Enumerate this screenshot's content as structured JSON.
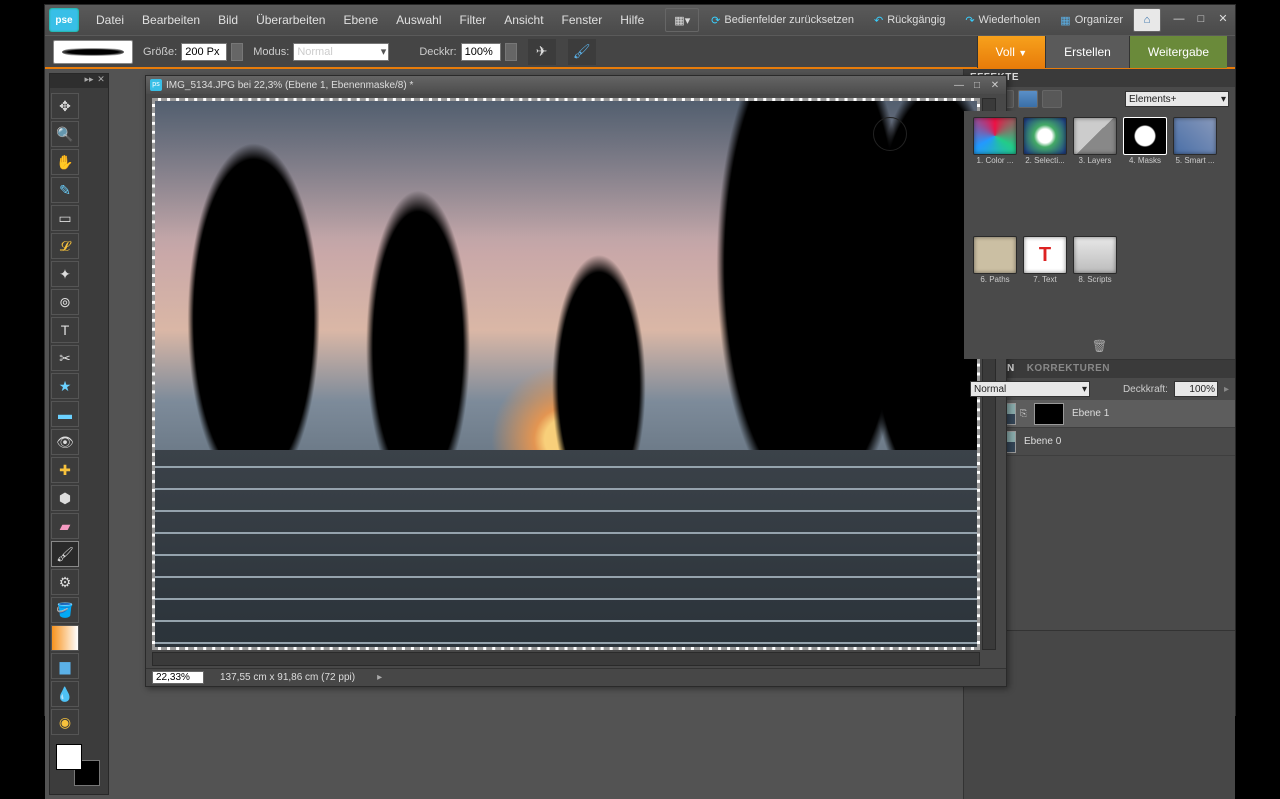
{
  "menu": {
    "items": [
      "Datei",
      "Bearbeiten",
      "Bild",
      "Überarbeiten",
      "Ebene",
      "Auswahl",
      "Filter",
      "Ansicht",
      "Fenster",
      "Hilfe"
    ]
  },
  "topbuttons": {
    "reset": "Bedienfelder zurücksetzen",
    "undo": "Rückgängig",
    "redo": "Wiederholen",
    "organizer": "Organizer"
  },
  "options": {
    "size_label": "Größe:",
    "size_value": "200 Px",
    "mode_label": "Modus:",
    "mode_value": "Normal",
    "opacity_label": "Deckkr:",
    "opacity_value": "100%"
  },
  "tabs": {
    "full": "Voll",
    "create": "Erstellen",
    "share": "Weitergabe"
  },
  "doc": {
    "title": "IMG_5134.JPG bei 22,3% (Ebene 1, Ebenenmaske/8) *",
    "zoom": "22,33%",
    "dims": "137,55 cm x 91,86 cm (72 ppi)"
  },
  "effects": {
    "title": "EFFEKTE",
    "dropdown": "Elements+",
    "items": [
      "1. Color ...",
      "2. Selecti...",
      "3. Layers",
      "4. Masks",
      "5. Smart ...",
      "6. Paths",
      "7. Text",
      "8. Scripts"
    ],
    "selected": 3
  },
  "layers": {
    "tab1": "EBENEN",
    "tab2": "KORREKTUREN",
    "blend": "Normal",
    "opacity_label": "Deckkraft:",
    "opacity_value": "100%",
    "rows": [
      {
        "name": "Ebene 1",
        "mask": true
      },
      {
        "name": "Ebene 0",
        "mask": false
      }
    ]
  },
  "logo": "pse"
}
